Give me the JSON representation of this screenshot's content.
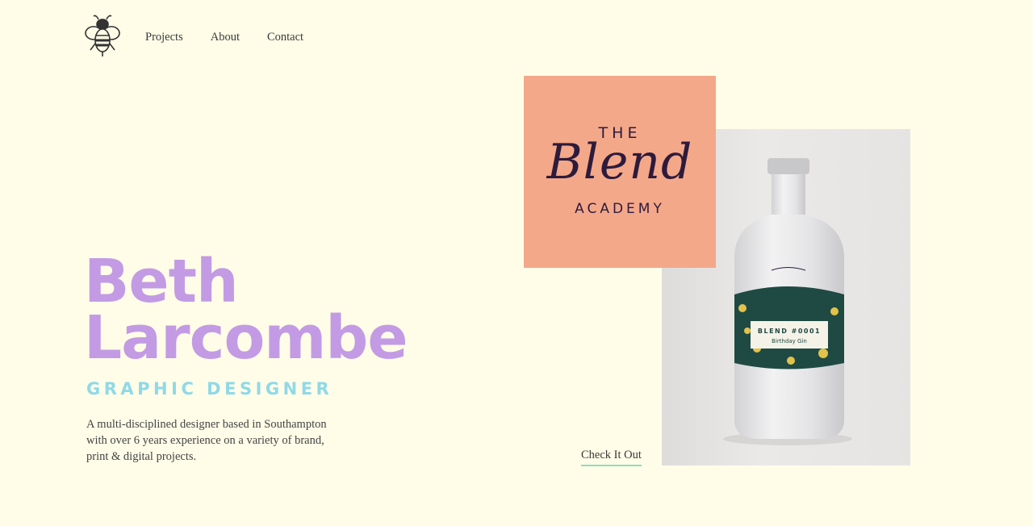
{
  "nav": {
    "logo_icon": "bee-icon",
    "items": [
      {
        "label": "Projects"
      },
      {
        "label": "About"
      },
      {
        "label": "Contact"
      }
    ]
  },
  "hero": {
    "name_line1": "Beth",
    "name_line2": "Larcombe",
    "role": "GRAPHIC DESIGNER",
    "bio": "A multi-disciplined designer based in Southampton with over 6 years experience on a variety of brand, print & digital projects."
  },
  "feature": {
    "brand_the": "THE",
    "brand_name": "Blend",
    "brand_academy": "ACADEMY",
    "bottle_label_title": "BLEND #0001",
    "bottle_label_subtitle": "Birthday Gin",
    "cta_label": "Check It Out"
  },
  "colors": {
    "background": "#fffde8",
    "name": "#c39be4",
    "role": "#8fd9e8",
    "card": "#f4a88a",
    "cta_underline": "#8fdcc0"
  }
}
